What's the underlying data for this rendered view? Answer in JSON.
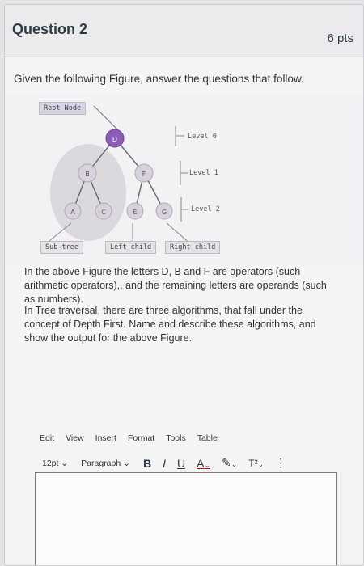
{
  "question": {
    "title": "Question 2",
    "points": "6 pts",
    "prompt": "Given the following Figure, answer the questions that follow."
  },
  "figure": {
    "root_label": "Root Node",
    "levels": [
      "Level 0",
      "Level 1",
      "Level 2"
    ],
    "nodes": [
      "D",
      "B",
      "F",
      "A",
      "C",
      "E",
      "G"
    ],
    "subtree_label": "Sub-tree",
    "left_child_label": "Left child",
    "right_child_label": "Right child"
  },
  "body": {
    "para1": "In the above Figure the letters D, B and F are operators (such arithmetic operators),, and the remaining letters are operands (such as numbers).",
    "para2": "In Tree traversal, there are three algorithms, that fall under the concept of Depth First. Name and describe these algorithms, and show the output for the above Figure."
  },
  "editor": {
    "menu": [
      "Edit",
      "View",
      "Insert",
      "Format",
      "Tools",
      "Table"
    ],
    "font_size": "12pt",
    "block_style": "Paragraph",
    "bold": "B",
    "italic": "I",
    "underline": "U",
    "font_color": "A",
    "highlight": "✎",
    "superscript": "T²",
    "more": "⋮",
    "answer_text": ""
  }
}
